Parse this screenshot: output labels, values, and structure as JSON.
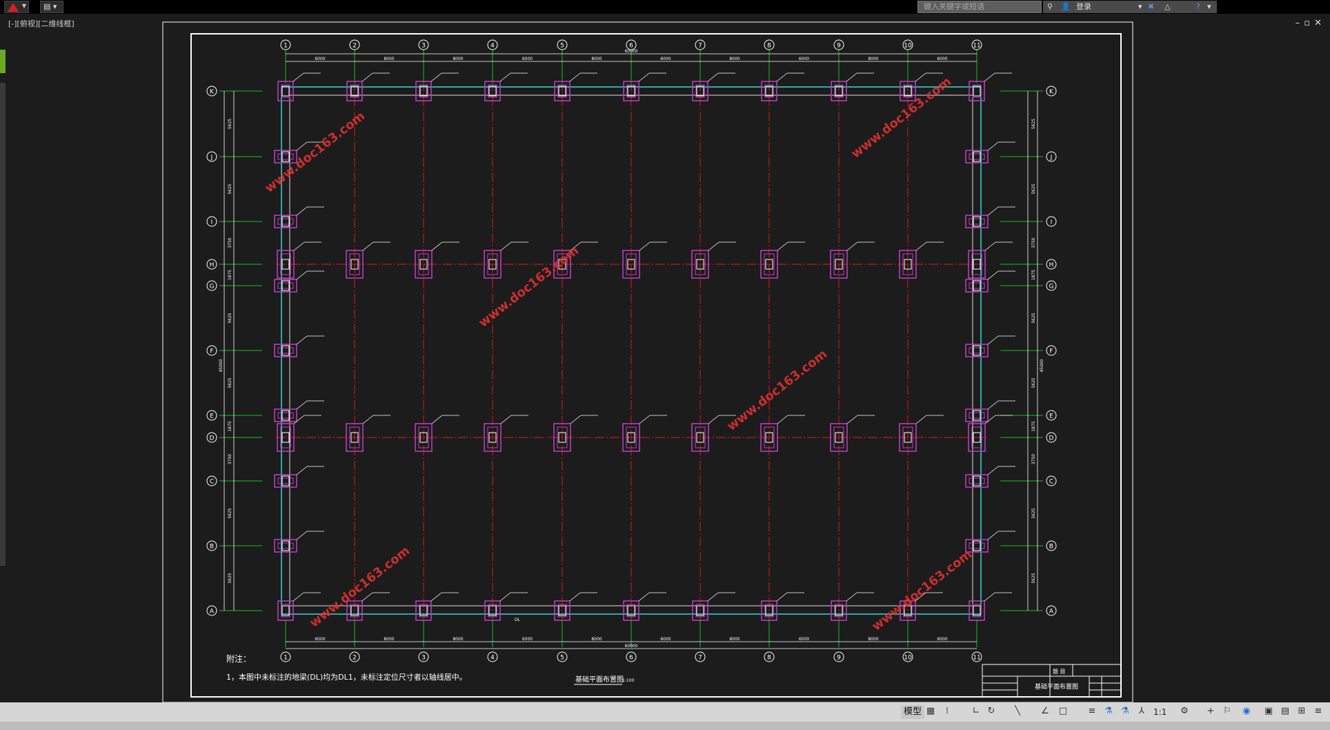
{
  "titlebar": {
    "search_placeholder": "键入关键字或短语",
    "login_label": "登录",
    "qa_tool": "▤"
  },
  "viewport_label": "[-][俯视][二维线框]",
  "drawing": {
    "col_labels": [
      "1",
      "2",
      "3",
      "4",
      "5",
      "6",
      "7",
      "8",
      "9",
      "10",
      "11"
    ],
    "row_labels": [
      "K",
      "J",
      "I",
      "H",
      "G",
      "F",
      "E",
      "D",
      "C",
      "B",
      "A"
    ],
    "top_dims": [
      "6000",
      "8000",
      "8000",
      "6000",
      "8000",
      "6000",
      "8000",
      "6000",
      "8000",
      "6000"
    ],
    "overall_width": "60000",
    "overall_height": "45000",
    "bottom_dims": [
      "6000",
      "8000",
      "8000",
      "6000",
      "8000",
      "6000",
      "8000",
      "6000",
      "8000",
      "6000"
    ],
    "left_dims": [
      "5625",
      "5625",
      "3750",
      "1875",
      "5625",
      "5625",
      "1875",
      "3750",
      "5625",
      "5625"
    ],
    "watermark": "www.doc163.com",
    "notes_title": "附注：",
    "notes_line1": "1，本图中未标注的地梁(DL)均为DL1，未标注定位尺寸者以轴线居中。",
    "plan_title": "基础平面布置图",
    "plan_scale": "1:100",
    "title_block_name": "基础平面布置图",
    "title_block_head": "题 目",
    "bottom_tag": "DL"
  },
  "statusbar": {
    "model_label": "模型",
    "scale_label": "1:1"
  }
}
